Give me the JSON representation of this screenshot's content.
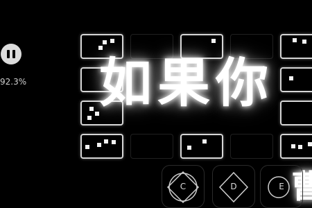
{
  "hud": {
    "progress_text": "92.3%",
    "progress_value": 92.3
  },
  "title": {
    "main": "如果你",
    "fragment": "曹"
  },
  "grid": [
    {
      "row": 0,
      "col": 0,
      "state": "lit",
      "dots": [
        [
          0.55,
          0.25
        ],
        [
          0.75,
          0.18
        ],
        [
          0.45,
          0.55
        ]
      ]
    },
    {
      "row": 0,
      "col": 1,
      "state": "dim",
      "dots": []
    },
    {
      "row": 0,
      "col": 2,
      "state": "lit",
      "dots": [
        [
          0.8,
          0.18
        ]
      ]
    },
    {
      "row": 0,
      "col": 3,
      "state": "dim",
      "dots": []
    },
    {
      "row": 0,
      "col": 4,
      "state": "lit",
      "dots": [
        [
          0.3,
          0.15
        ],
        [
          0.55,
          0.22
        ]
      ]
    },
    {
      "row": 1,
      "col": 0,
      "state": "lit",
      "dots": []
    },
    {
      "row": 1,
      "col": 4,
      "state": "lit",
      "dots": [
        [
          0.2,
          0.4
        ]
      ]
    },
    {
      "row": 2,
      "col": 0,
      "state": "lit",
      "dots": [
        [
          0.2,
          0.25
        ],
        [
          0.35,
          0.5
        ],
        [
          0.15,
          0.7
        ]
      ]
    },
    {
      "row": 2,
      "col": 4,
      "state": "lit",
      "dots": []
    },
    {
      "row": 3,
      "col": 0,
      "state": "lit",
      "dots": [
        [
          0.1,
          0.5
        ],
        [
          0.4,
          0.4
        ],
        [
          0.6,
          0.2
        ],
        [
          0.8,
          0.25
        ]
      ]
    },
    {
      "row": 3,
      "col": 1,
      "state": "dim",
      "dots": []
    },
    {
      "row": 3,
      "col": 2,
      "state": "lit",
      "dots": [
        [
          0.55,
          0.2
        ],
        [
          0.15,
          0.55
        ]
      ]
    },
    {
      "row": 3,
      "col": 3,
      "state": "dim",
      "dots": []
    },
    {
      "row": 3,
      "col": 4,
      "state": "lit",
      "dots": [
        [
          0.25,
          0.45
        ],
        [
          0.45,
          0.5
        ],
        [
          0.7,
          0.35
        ]
      ]
    }
  ],
  "keys": [
    {
      "label": "C",
      "shape": "diamond-circle"
    },
    {
      "label": "D",
      "shape": "diamond"
    },
    {
      "label": "E",
      "shape": "circle"
    }
  ]
}
